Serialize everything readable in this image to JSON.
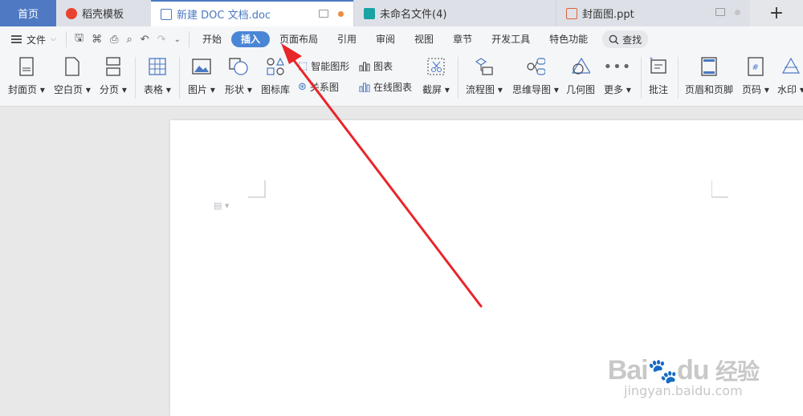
{
  "tabs": {
    "home": "首页",
    "template": "稻壳模板",
    "doc": "新建 DOC 文档.doc",
    "unnamed": "未命名文件(4)",
    "ppt": "封面图.ppt",
    "new_tab": "+"
  },
  "menu": {
    "file": "文件",
    "tabs": [
      "开始",
      "插入",
      "页面布局",
      "引用",
      "审阅",
      "视图",
      "章节",
      "开发工具",
      "特色功能"
    ],
    "active": "插入",
    "search": "查找"
  },
  "ribbon": {
    "cover": "封面页",
    "blank": "空白页",
    "pagebreak": "分页",
    "table": "表格",
    "picture": "图片",
    "shape": "形状",
    "iconlib": "图标库",
    "smartart": "智能图形",
    "relation": "关系图",
    "chart": "图表",
    "onlinechart": "在线图表",
    "screenshot": "截屏",
    "flowchart": "流程图",
    "mindmap": "思维导图",
    "geometry": "几何图",
    "more": "更多",
    "comment": "批注",
    "headerfooter": "页眉和页脚",
    "pagenum": "页码",
    "watermark": "水印"
  },
  "watermark": {
    "brand": "Bai",
    "brand2": "du",
    "brand_cn": "经验",
    "url": "jingyan.baidu.com"
  },
  "colors": {
    "accent": "#4a86d6",
    "home_tab": "#4f79c3",
    "arrow": "#e8262a"
  }
}
